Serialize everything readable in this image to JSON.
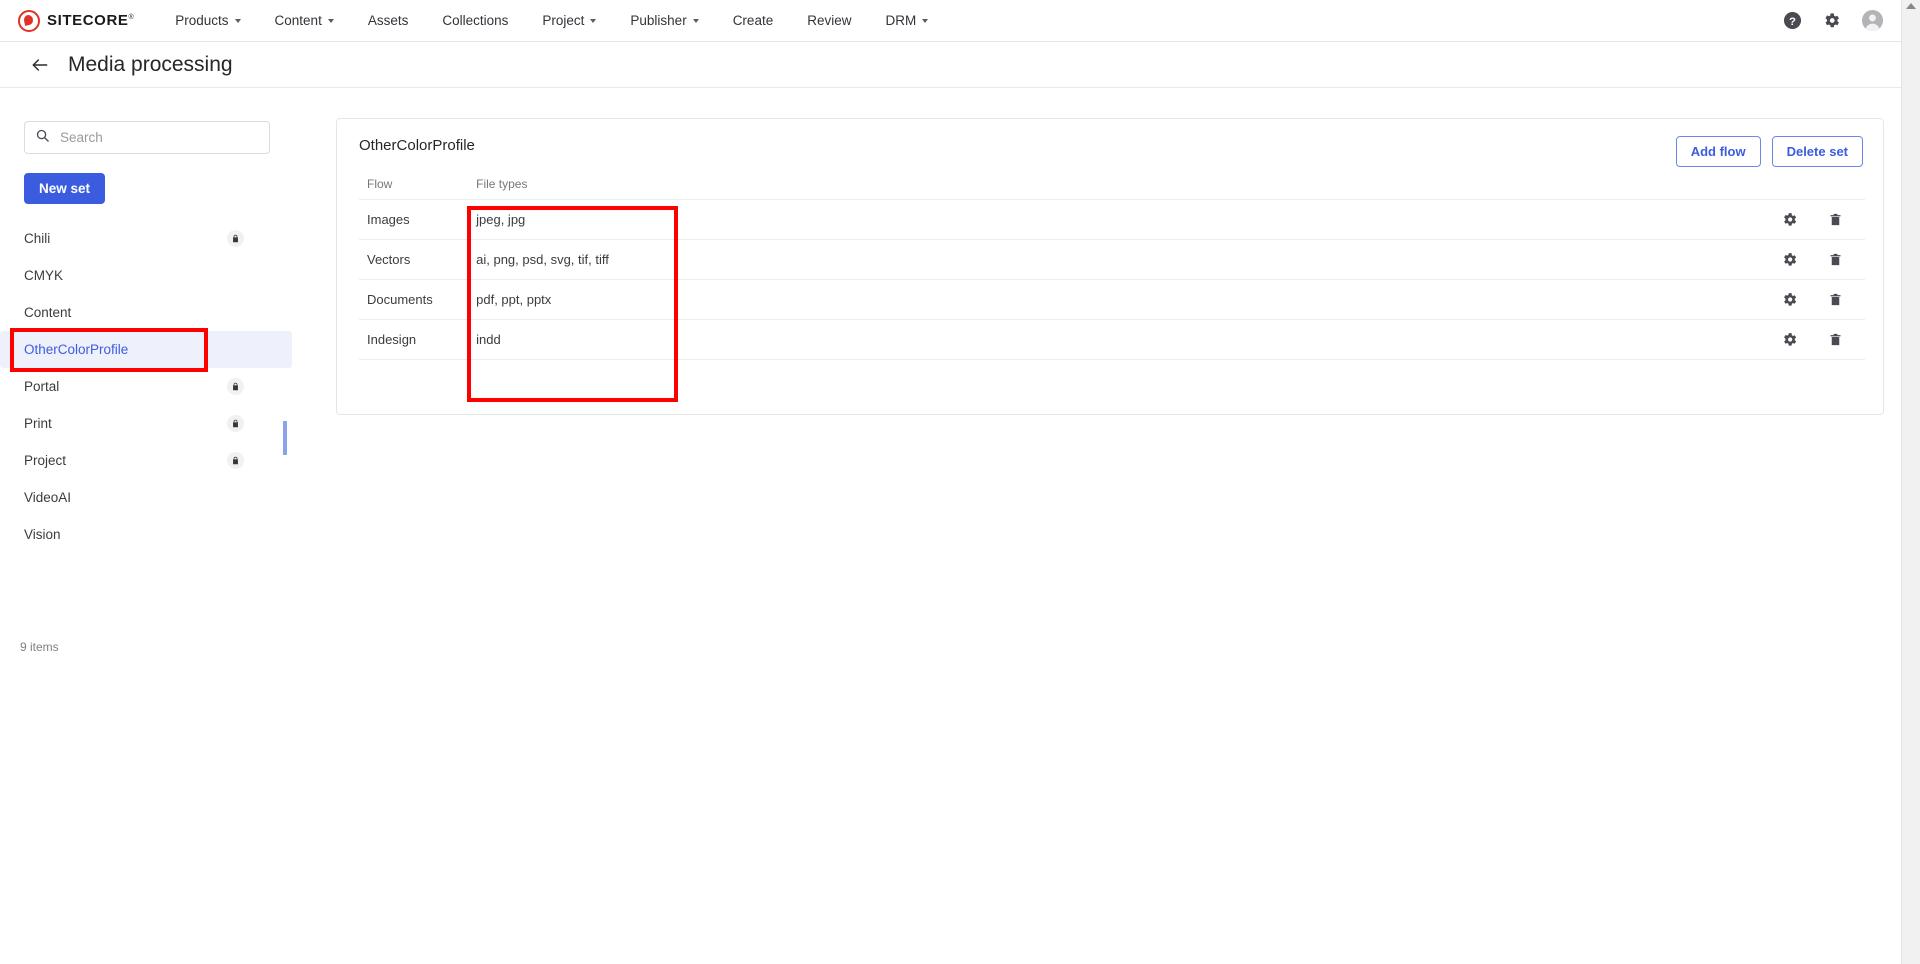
{
  "brand": {
    "name": "SITECORE",
    "logo_color": "#e03127"
  },
  "topnav": {
    "items": [
      {
        "label": "Products",
        "caret": true
      },
      {
        "label": "Content",
        "caret": true
      },
      {
        "label": "Assets",
        "caret": false
      },
      {
        "label": "Collections",
        "caret": false
      },
      {
        "label": "Project",
        "caret": true
      },
      {
        "label": "Publisher",
        "caret": true
      },
      {
        "label": "Create",
        "caret": false
      },
      {
        "label": "Review",
        "caret": false
      },
      {
        "label": "DRM",
        "caret": true
      }
    ],
    "right_icons": [
      "help-icon",
      "gear-icon",
      "avatar-icon"
    ]
  },
  "header": {
    "title": "Media processing",
    "back_icon": "back-arrow-icon"
  },
  "sidebar": {
    "search": {
      "placeholder": "Search",
      "value": "",
      "icon": "search-icon"
    },
    "new_set_label": "New set",
    "items": [
      {
        "label": "Chili",
        "locked": true,
        "selected": false
      },
      {
        "label": "CMYK",
        "locked": false,
        "selected": false
      },
      {
        "label": "Content",
        "locked": false,
        "selected": false
      },
      {
        "label": "OtherColorProfile",
        "locked": false,
        "selected": true
      },
      {
        "label": "Portal",
        "locked": true,
        "selected": false
      },
      {
        "label": "Print",
        "locked": true,
        "selected": false
      },
      {
        "label": "Project",
        "locked": true,
        "selected": false
      },
      {
        "label": "VideoAI",
        "locked": false,
        "selected": false
      },
      {
        "label": "Vision",
        "locked": false,
        "selected": false
      }
    ],
    "items_count": "9 items"
  },
  "main": {
    "set_title": "OtherColorProfile",
    "add_flow_label": "Add flow",
    "delete_set_label": "Delete set",
    "columns": {
      "flow": "Flow",
      "file_types": "File types",
      "actions": ""
    },
    "rows": [
      {
        "flow": "Images",
        "file_types": "jpeg, jpg"
      },
      {
        "flow": "Vectors",
        "file_types": "ai, png, psd, svg, tif, tiff"
      },
      {
        "flow": "Documents",
        "file_types": "pdf, ppt, pptx"
      },
      {
        "flow": "Indesign",
        "file_types": "indd"
      }
    ],
    "row_icons": [
      "settings-gear-icon",
      "delete-trash-icon"
    ]
  },
  "annotations": {
    "highlight_color": "#ff0000",
    "boxes": [
      "sidebar-selected-set",
      "file-types-column"
    ]
  }
}
